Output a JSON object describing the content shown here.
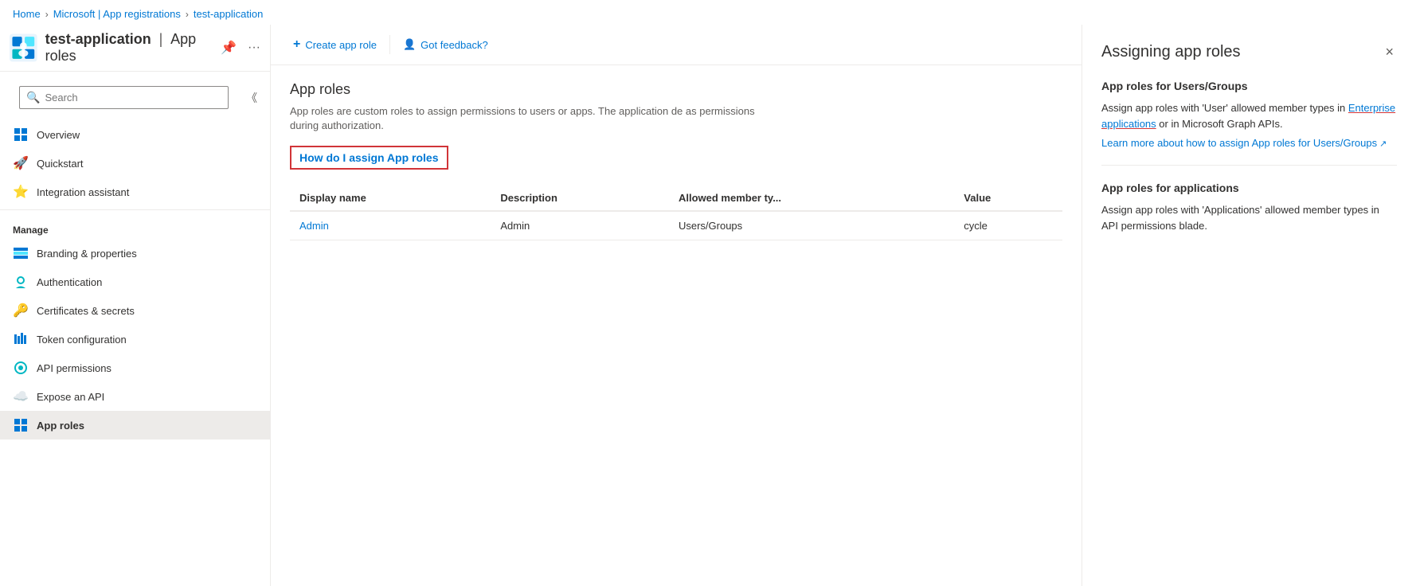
{
  "breadcrumb": {
    "items": [
      "Home",
      "Microsoft | App registrations",
      "test-application"
    ]
  },
  "sidebar": {
    "app_name": "test-application",
    "separator": "|",
    "page_title": "App roles",
    "search_placeholder": "Search",
    "collapse_title": "Collapse",
    "nav_items": [
      {
        "id": "overview",
        "label": "Overview",
        "icon": "grid"
      },
      {
        "id": "quickstart",
        "label": "Quickstart",
        "icon": "rocket"
      },
      {
        "id": "integration-assistant",
        "label": "Integration assistant",
        "icon": "star"
      }
    ],
    "manage_label": "Manage",
    "manage_items": [
      {
        "id": "branding",
        "label": "Branding & properties",
        "icon": "brush"
      },
      {
        "id": "authentication",
        "label": "Authentication",
        "icon": "shield"
      },
      {
        "id": "certificates",
        "label": "Certificates & secrets",
        "icon": "key"
      },
      {
        "id": "token",
        "label": "Token configuration",
        "icon": "bar"
      },
      {
        "id": "api-permissions",
        "label": "API permissions",
        "icon": "api"
      },
      {
        "id": "expose-api",
        "label": "Expose an API",
        "icon": "cloud"
      },
      {
        "id": "app-roles",
        "label": "App roles",
        "icon": "grid2",
        "active": true
      }
    ]
  },
  "toolbar": {
    "create_label": "Create app role",
    "feedback_label": "Got feedback?"
  },
  "content": {
    "title": "App roles",
    "description": "App roles are custom roles to assign permissions to users or apps. The application de as permissions during authorization.",
    "assign_link_label": "How do I assign App roles",
    "table": {
      "columns": [
        "Display name",
        "Description",
        "Allowed member ty...",
        "Value"
      ],
      "rows": [
        {
          "display_name": "Admin",
          "description": "Admin",
          "allowed_member": "Users/Groups",
          "value": "cycle"
        }
      ]
    }
  },
  "panel": {
    "title": "Assigning app roles",
    "close_label": "×",
    "section1": {
      "title": "App roles for Users/Groups",
      "text_before": "Assign app roles with 'User' allowed member types in ",
      "link_text": "Enterprise applications",
      "text_after": " or in Microsoft Graph APIs.",
      "learn_more_label": "Learn more about how to assign App roles for Users/Groups"
    },
    "section2": {
      "title": "App roles for applications",
      "text": "Assign app roles with 'Applications' allowed member types in API permissions blade."
    }
  }
}
